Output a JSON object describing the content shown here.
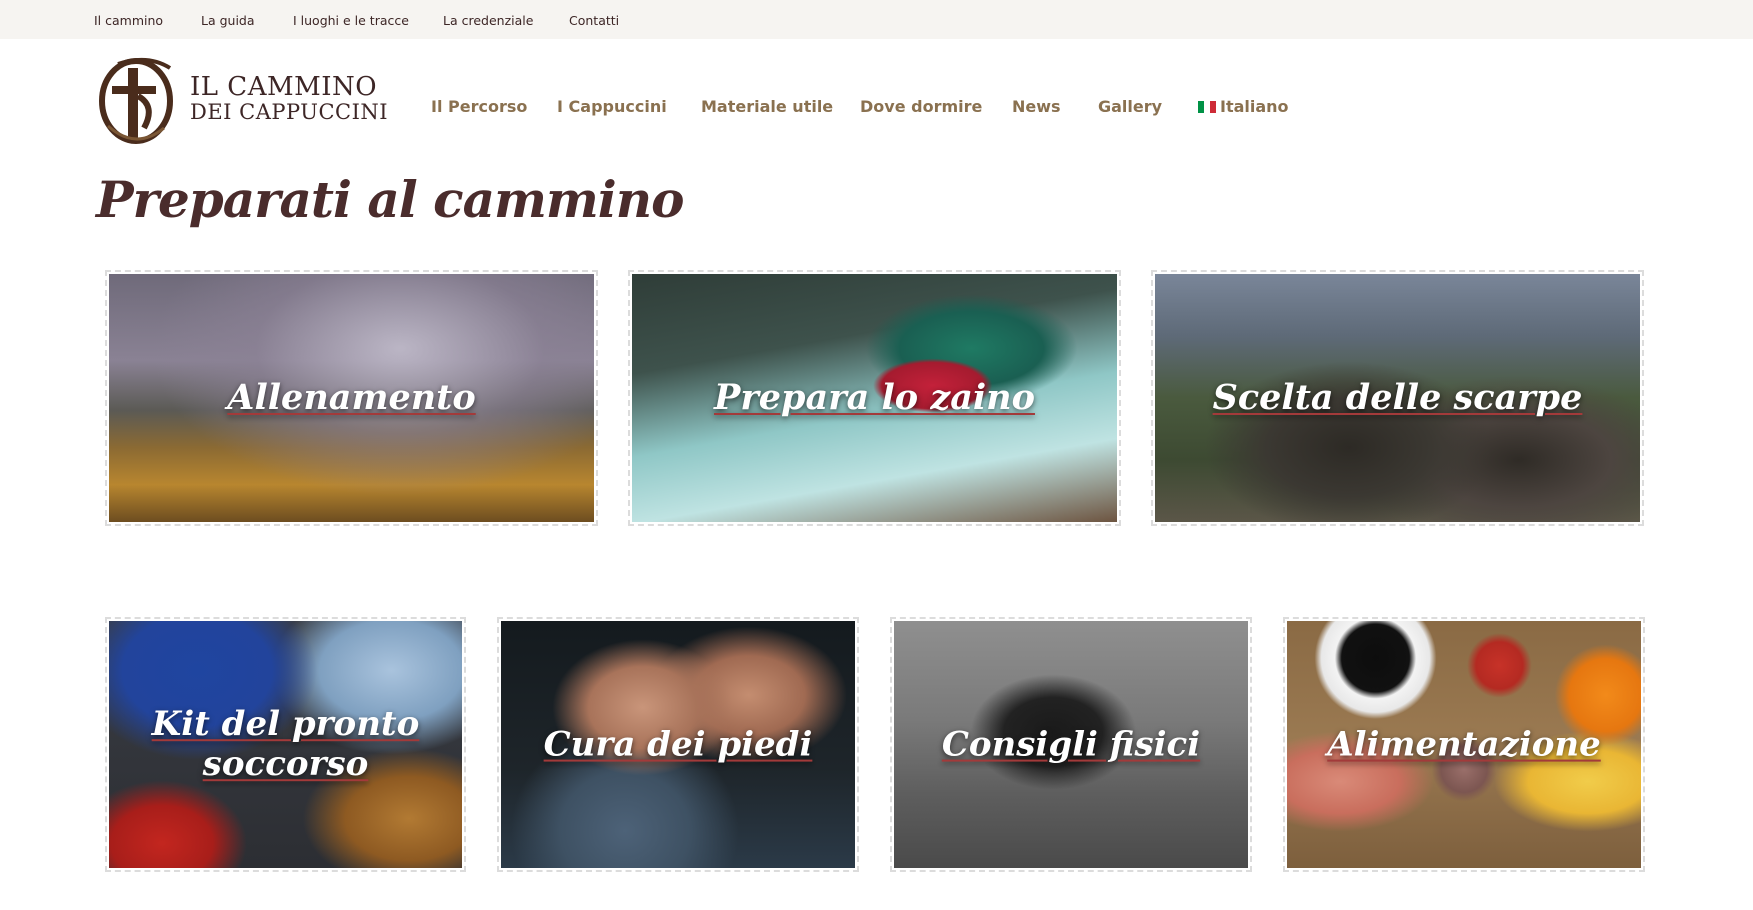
{
  "topbar": {
    "links": [
      "Il cammino",
      "La guida",
      "I luoghi e le tracce",
      "La credenziale",
      "Contatti"
    ]
  },
  "brand": {
    "line1": "IL CAMMINO",
    "line2": "DEI CAPPUCCINI"
  },
  "nav": {
    "items": [
      "Il Percorso",
      "I Cappuccini",
      "Materiale utile",
      "Dove dormire",
      "News",
      "Gallery"
    ],
    "language": "Italiano"
  },
  "page": {
    "title": "Preparati al cammino"
  },
  "cards_row1": [
    {
      "label": "Allenamento"
    },
    {
      "label": "Prepara lo zaino"
    },
    {
      "label": "Scelta delle scarpe"
    }
  ],
  "cards_row2": [
    {
      "label": "Kit del pronto soccorso"
    },
    {
      "label": "Cura dei piedi"
    },
    {
      "label": "Consigli fisici"
    },
    {
      "label": "Alimentazione"
    }
  ],
  "colors": {
    "brand_brown": "#3d2626",
    "nav_gold": "#8a7150",
    "title_brown": "#4a2c2c",
    "underline_red": "#a33a3a",
    "topbar_bg": "#f6f4f1"
  }
}
